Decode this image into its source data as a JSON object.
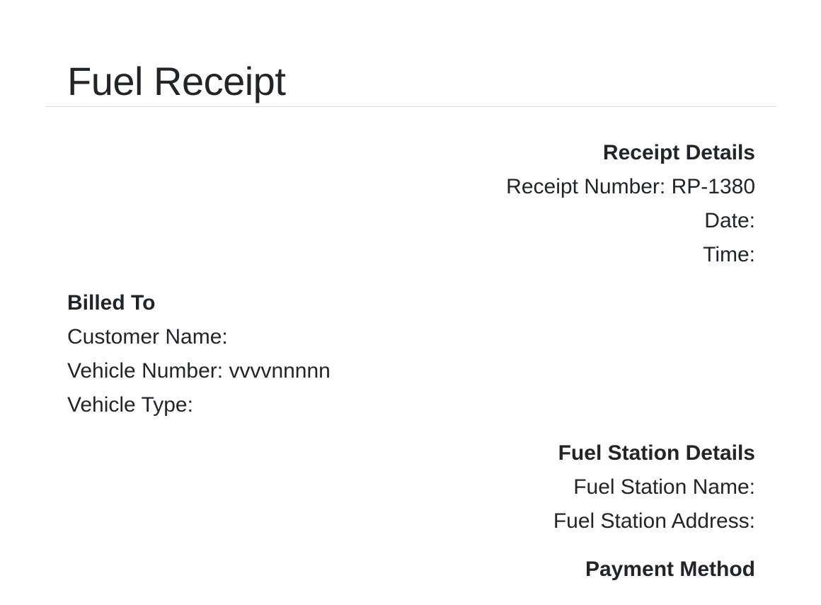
{
  "title": "Fuel Receipt",
  "receipt_details": {
    "heading": "Receipt Details",
    "receipt_number": "Receipt Number: RP-1380",
    "date": "Date:",
    "time": "Time:"
  },
  "billed_to": {
    "heading": "Billed To",
    "customer_name": "Customer Name:",
    "vehicle_number": "Vehicle Number: vvvvnnnnn",
    "vehicle_type": "Vehicle Type:"
  },
  "fuel_station": {
    "heading": "Fuel Station Details",
    "name": "Fuel Station Name:",
    "address": "Fuel Station Address:"
  },
  "payment": {
    "heading": "Payment Method"
  }
}
